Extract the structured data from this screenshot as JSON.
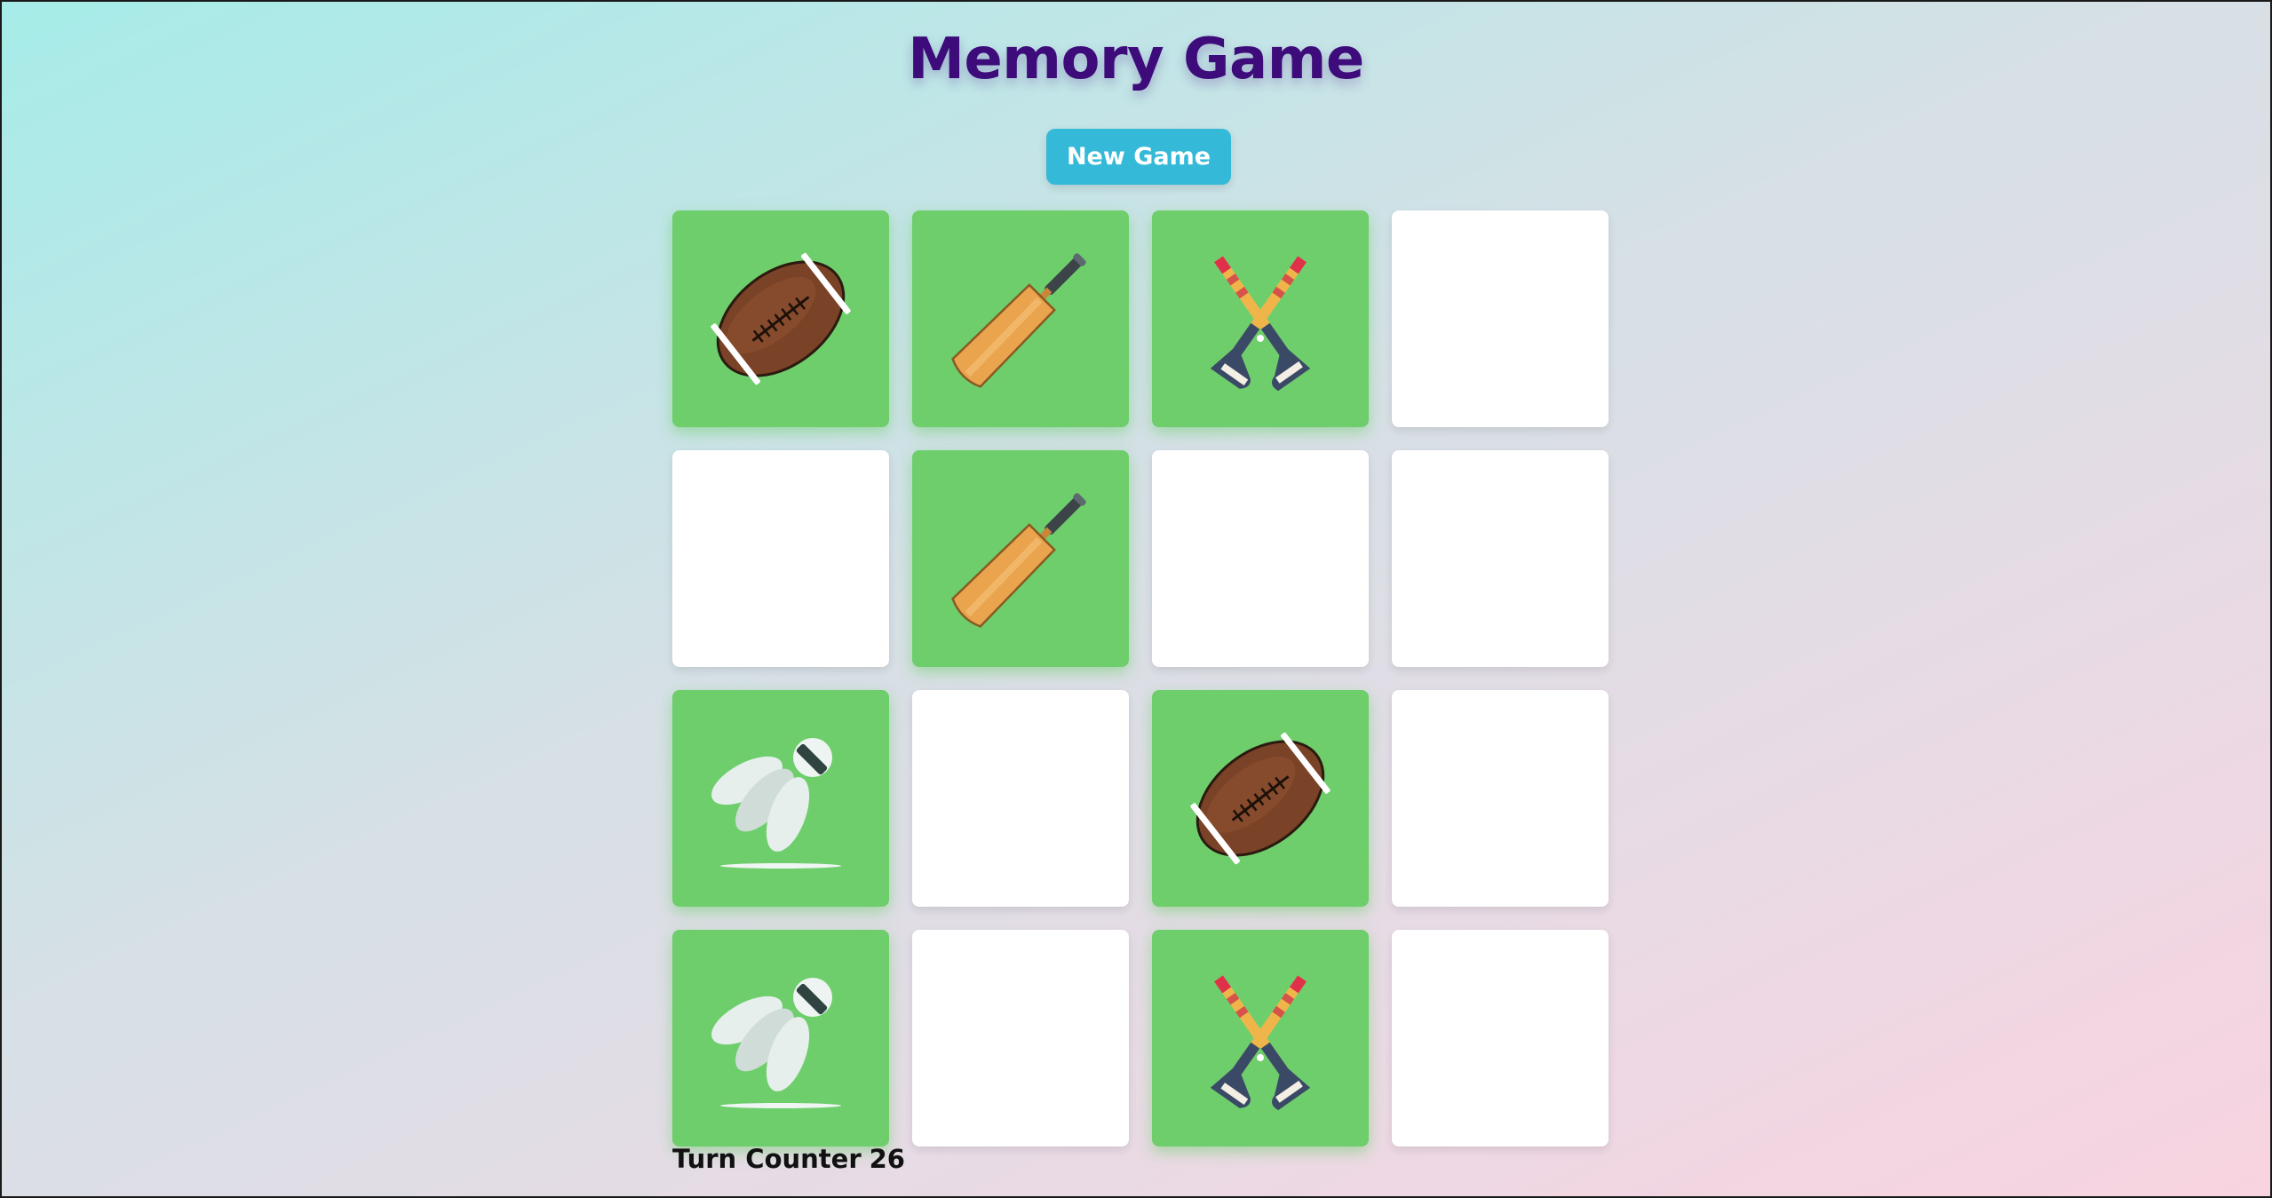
{
  "title": "Memory Game",
  "new_game_label": "New Game",
  "turn_counter": {
    "label": "Turn Counter",
    "value": "26"
  },
  "board": {
    "columns": 4,
    "rows": 4,
    "cards": [
      {
        "state": "matched",
        "icon": "football-icon"
      },
      {
        "state": "matched",
        "icon": "cricket-bat-icon"
      },
      {
        "state": "matched",
        "icon": "hockey-sticks-icon"
      },
      {
        "state": "hidden",
        "icon": ""
      },
      {
        "state": "hidden",
        "icon": ""
      },
      {
        "state": "matched",
        "icon": "cricket-bat-icon"
      },
      {
        "state": "hidden",
        "icon": ""
      },
      {
        "state": "hidden",
        "icon": ""
      },
      {
        "state": "matched",
        "icon": "shuttlecock-icon"
      },
      {
        "state": "hidden",
        "icon": ""
      },
      {
        "state": "matched",
        "icon": "football-icon"
      },
      {
        "state": "hidden",
        "icon": ""
      },
      {
        "state": "matched",
        "icon": "shuttlecock-icon"
      },
      {
        "state": "hidden",
        "icon": ""
      },
      {
        "state": "matched",
        "icon": "hockey-sticks-icon"
      },
      {
        "state": "hidden",
        "icon": ""
      }
    ]
  },
  "colors": {
    "title": "#3d0b7a",
    "button": "#34bad8",
    "revealed_card": "#6ece6c",
    "hidden_card": "#ffffff"
  }
}
